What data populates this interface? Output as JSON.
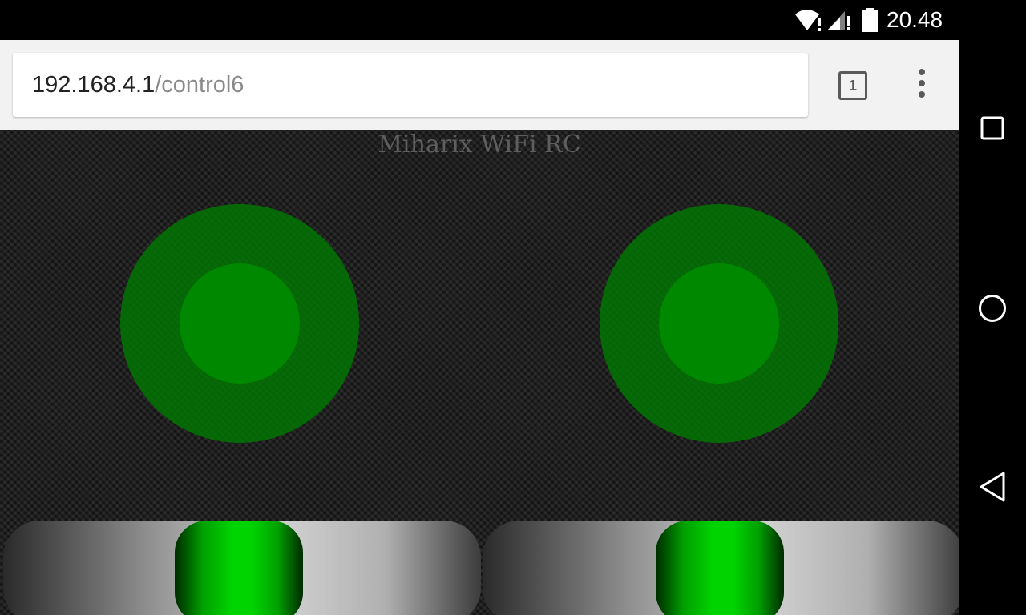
{
  "status_bar": {
    "time": "20.48",
    "icons": [
      "wifi-alert-icon",
      "signal-alert-icon",
      "battery-icon"
    ]
  },
  "browser": {
    "url_host": "192.168.4.1",
    "url_path": "/control6",
    "tab_count": "1",
    "icons": [
      "tab-switcher-icon",
      "overflow-menu-icon"
    ]
  },
  "page": {
    "title": "Miharix WiFi RC",
    "joysticks": [
      {
        "id": "left",
        "x": 0,
        "y": 0
      },
      {
        "id": "right",
        "x": 0,
        "y": 0
      }
    ],
    "sliders": [
      {
        "id": "left",
        "value": 0.5
      },
      {
        "id": "right",
        "value": 0.5
      }
    ]
  },
  "colors": {
    "joystick": "#0a7a0a",
    "slider_thumb": "#00d400",
    "page_background": "#1c1c1c"
  },
  "nav_bar": {
    "icons": [
      "recents-square-icon",
      "home-circle-icon",
      "back-triangle-icon"
    ]
  }
}
